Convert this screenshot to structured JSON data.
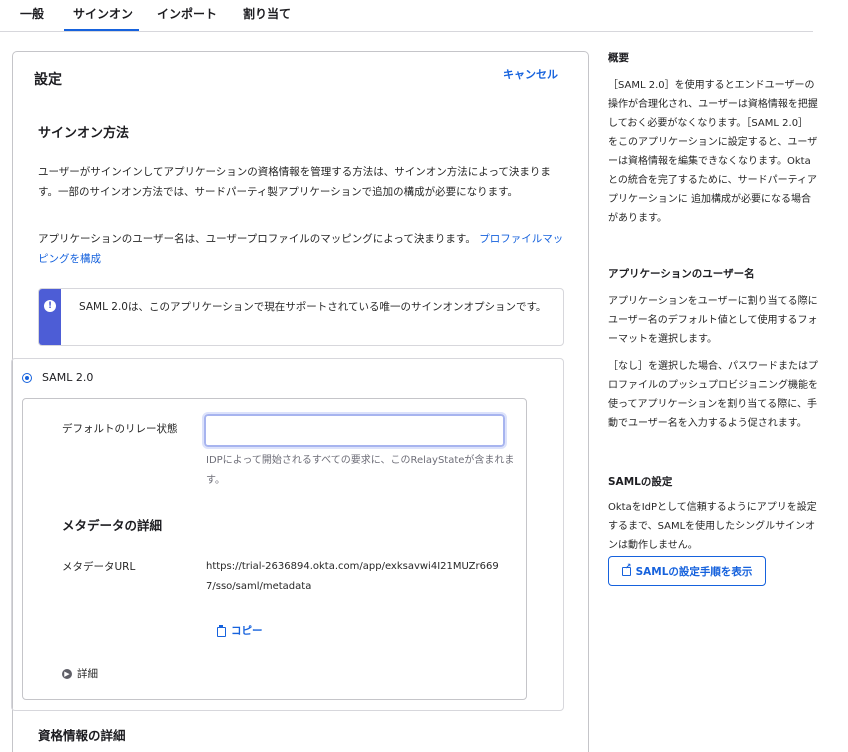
{
  "tabs": [
    {
      "label": "一般"
    },
    {
      "label": "サインオン"
    },
    {
      "label": "インポート"
    },
    {
      "label": "割り当て"
    }
  ],
  "active_tab": "サインオン",
  "settings": {
    "title": "設定",
    "cancel_label": "キャンセル",
    "signon_method_title": "サインオン方法",
    "signon_description": "ユーザーがサインインしてアプリケーションの資格情報を管理する方法は、サインオン方法によって決まります。一部のサインオン方法では、サードパーティ製アプリケーションで追加の構成が必要になります。",
    "username_description": "アプリケーションのユーザー名は、ユーザープロファイルのマッピングによって決まります。",
    "profile_mapping_link": "プロファイルマッピングを構成",
    "callout_text": "SAML 2.0は、このアプリケーションで現在サポートされている唯一のサインオンオプションです。",
    "callout_icon": "info-icon",
    "saml_option_label": "SAML 2.0",
    "relay_state_label": "デフォルトのリレー状態",
    "relay_state_value": "",
    "relay_state_hint": "IDPによって開始されるすべての要求に、このRelayStateが含まれます。",
    "metadata_title": "メタデータの詳細",
    "metadata_url_label": "メタデータURL",
    "metadata_url_value": "https://trial-2636894.okta.com/app/exksavwi4I21MUZr6697/sso/saml/metadata",
    "copy_label": "コピー",
    "details_label": "詳細",
    "credentials_title": "資格情報の詳細"
  },
  "sidebar": {
    "overview_title": "概要",
    "overview_text": "［SAML 2.0］を使用するとエンドユーザーの操作が合理化され、ユーザーは資格情報を把握しておく必要がなくなります。［SAML 2.0］をこのアプリケーションに設定すると、ユーザーは資格情報を編集できなくなります。Oktaとの統合を完了するために、サードパーティアプリケーションに 追加構成が必要になる場合があります。",
    "username_title": "アプリケーションのユーザー名",
    "username_text1": "アプリケーションをユーザーに割り当てる際にユーザー名のデフォルト値として使用するフォーマットを選択します。",
    "username_text2": "［なし］を選択した場合、パスワードまたはプロファイルのプッシュプロビジョニング機能を使ってアプリケーションを割り当てる際に、手動でユーザー名を入力するよう促されます。",
    "saml_setup_title": "SAMLの設定",
    "saml_setup_text": "OktaをIdPとして信頼するようにアプリを設定するまで、SAMLを使用したシングルサインオンは動作しません。",
    "saml_setup_button": "SAMLの設定手順を表示"
  },
  "colors": {
    "accent": "#1662dd",
    "callout": "#4d5dd6",
    "border": "#d7d7dc"
  }
}
